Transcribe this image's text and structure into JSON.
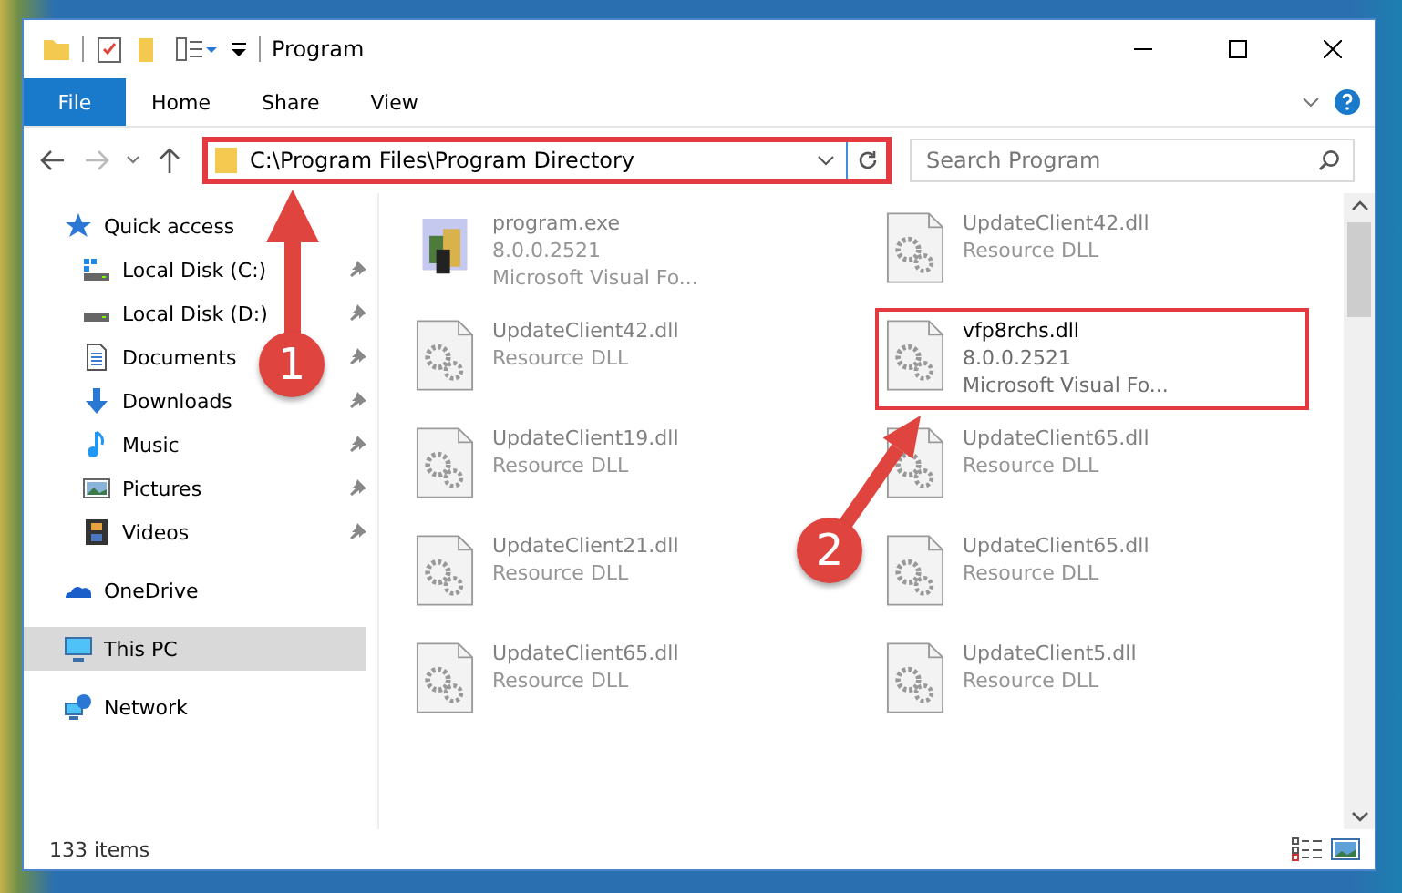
{
  "window": {
    "title": "Program"
  },
  "ribbon": {
    "file_button": "File",
    "tabs": [
      "Home",
      "Share",
      "View"
    ]
  },
  "address_bar": {
    "path": "C:\\Program Files\\Program Directory",
    "highlighted": true
  },
  "search": {
    "placeholder": "Search Program"
  },
  "sidebar": {
    "items": [
      {
        "label": "Quick access",
        "kind": "star",
        "selected": false,
        "children": [
          {
            "label": "Local Disk (C:)",
            "kind": "system-drive",
            "pinned": true,
            "selected": false
          },
          {
            "label": "Local Disk (D:)",
            "kind": "drive",
            "pinned": true,
            "selected": false
          },
          {
            "label": "Documents",
            "kind": "document",
            "pinned": true,
            "selected": false
          },
          {
            "label": "Downloads",
            "kind": "download",
            "pinned": true,
            "selected": false
          },
          {
            "label": "Music",
            "kind": "music",
            "pinned": true,
            "selected": false
          },
          {
            "label": "Pictures",
            "kind": "picture",
            "pinned": true,
            "selected": false
          },
          {
            "label": "Videos",
            "kind": "video",
            "pinned": true,
            "selected": false
          }
        ]
      },
      {
        "label": "OneDrive",
        "kind": "cloud",
        "selected": false
      },
      {
        "label": "This PC",
        "kind": "computer",
        "selected": true
      },
      {
        "label": "Network",
        "kind": "network",
        "selected": false
      }
    ]
  },
  "files": [
    {
      "name": "program.exe",
      "line_2": "8.0.0.2521",
      "line_3": "Microsoft Visual Fo...",
      "kind": "exe",
      "highlighted": false
    },
    {
      "name": "UpdateClient42.dll",
      "line_2": "Resource DLL",
      "kind": "dll",
      "highlighted": false
    },
    {
      "name": "UpdateClient42.dll",
      "line_2": "Resource DLL",
      "kind": "dll",
      "highlighted": false
    },
    {
      "name": "vfp8rchs.dll",
      "line_2": "8.0.0.2521",
      "line_3": "Microsoft Visual Fo...",
      "kind": "dll",
      "highlighted": true
    },
    {
      "name": "UpdateClient19.dll",
      "line_2": "Resource DLL",
      "kind": "dll",
      "highlighted": false
    },
    {
      "name": "UpdateClient65.dll",
      "line_2": "Resource DLL",
      "kind": "dll",
      "highlighted": false
    },
    {
      "name": "UpdateClient21.dll",
      "line_2": "Resource DLL",
      "kind": "dll",
      "highlighted": false
    },
    {
      "name": "UpdateClient65.dll",
      "line_2": "Resource DLL",
      "kind": "dll",
      "highlighted": false
    },
    {
      "name": "UpdateClient65.dll",
      "line_2": "Resource DLL",
      "kind": "dll",
      "highlighted": false
    },
    {
      "name": "UpdateClient5.dll",
      "line_2": "Resource DLL",
      "kind": "dll",
      "highlighted": false
    }
  ],
  "status_bar": {
    "item_count": "133 items"
  },
  "annotations": [
    {
      "label": "1"
    },
    {
      "label": "2"
    }
  ]
}
